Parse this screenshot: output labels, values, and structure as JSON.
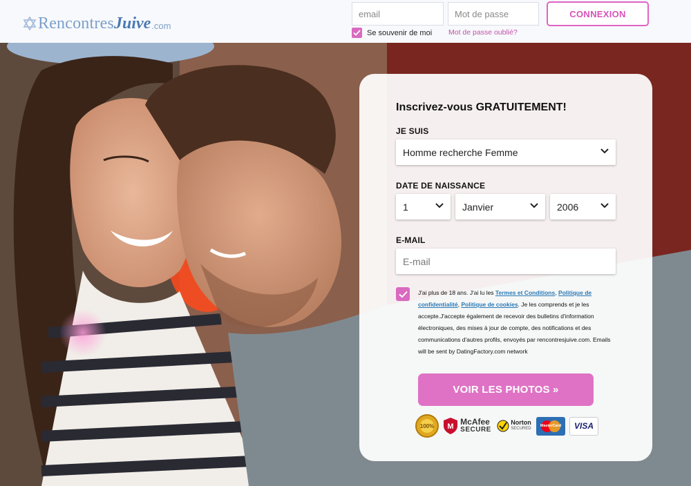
{
  "header": {
    "logo": {
      "part1": "Rencontres",
      "part2": "Juive",
      "part3": ".com"
    },
    "email_placeholder": "email",
    "password_placeholder": "Mot de passe",
    "login_label": "CONNEXION",
    "remember_label": "Se souvenir de moi",
    "forgot_label": "Mot de passe oublié?"
  },
  "signup": {
    "title": "Inscrivez-vous GRATUITEMENT!",
    "je_suis_label": "JE SUIS",
    "je_suis_value": "Homme recherche Femme",
    "dob_label": "DATE DE NAISSANCE",
    "dob_day": "1",
    "dob_month": "Janvier",
    "dob_year": "2006",
    "email_label": "E-MAIL",
    "email_placeholder": "E-mail",
    "terms": {
      "t1": "J'ai plus de 18 ans. J'ai lu les ",
      "link1": "Termes et Conditions",
      "t2": ", ",
      "link2": "Politique de confidentialité",
      "t3": ", ",
      "link3": "Politique de cookies",
      "t4": ". Je les comprends et je les accepte.J'accepte également de recevoir des bulletins d'information électroniques, des mises à jour de compte, des notifications et des communications d'autres profils, envoyés par rencontresjuive.com. Emails will be sent by DatingFactory.com network"
    },
    "submit_label": "VOIR LES PHOTOS »"
  },
  "badges": {
    "mcafee_1": "McAfee",
    "mcafee_2": "SECURE",
    "norton_1": "Norton",
    "norton_2": "SECURED",
    "mastercard": "MasterCard",
    "visa": "VISA"
  },
  "colors": {
    "accent": "#df72c5",
    "brand_blue": "#4b78b3",
    "link": "#2979b6"
  },
  "icons": [
    "star-of-david-icon",
    "checkbox-checked-icon",
    "chevron-down-icon"
  ]
}
